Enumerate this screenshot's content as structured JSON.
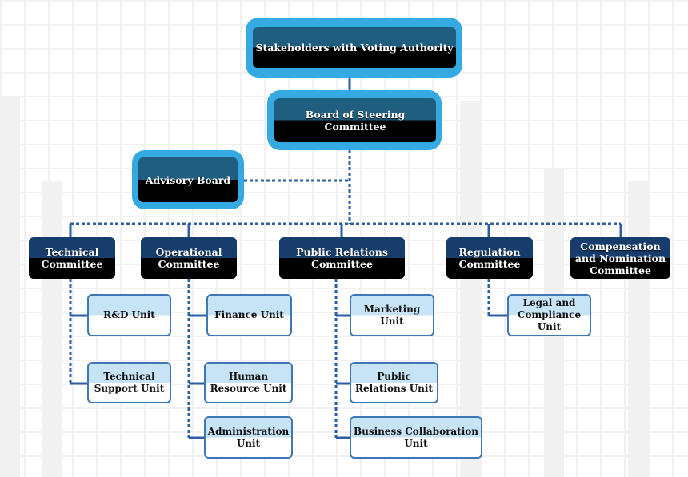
{
  "colors": {
    "accent": "#35a9e1",
    "line": "#2a5fa3",
    "committee": "#163d6c",
    "top": "#1f5e7f",
    "unit_fill": "#c7e4f6"
  },
  "top": {
    "label": "Stakeholders with Voting Authority"
  },
  "board": {
    "label": "Board of Steering Committee"
  },
  "advisory": {
    "label": "Advisory Board"
  },
  "committees": [
    {
      "label": "Technical Committee"
    },
    {
      "label": "Operational Committee"
    },
    {
      "label": "Public Relations Committee"
    },
    {
      "label": "Regulation Committee"
    },
    {
      "label": "Compensation and Nomination Committee"
    }
  ],
  "units": [
    {
      "label": "R&D Unit",
      "parent": "Technical Committee"
    },
    {
      "label": "Technical Support Unit",
      "parent": "Technical Committee"
    },
    {
      "label": "Finance Unit",
      "parent": "Operational Committee"
    },
    {
      "label": "Human Resource Unit",
      "parent": "Operational Committee"
    },
    {
      "label": "Administration Unit",
      "parent": "Operational Committee"
    },
    {
      "label": "Marketing Unit",
      "parent": "Public Relations Committee"
    },
    {
      "label": "Public Relations Unit",
      "parent": "Public Relations Committee"
    },
    {
      "label": "Business Collaboration Unit",
      "parent": "Public Relations Committee"
    },
    {
      "label": "Legal and Compliance Unit",
      "parent": "Regulation Committee"
    }
  ]
}
